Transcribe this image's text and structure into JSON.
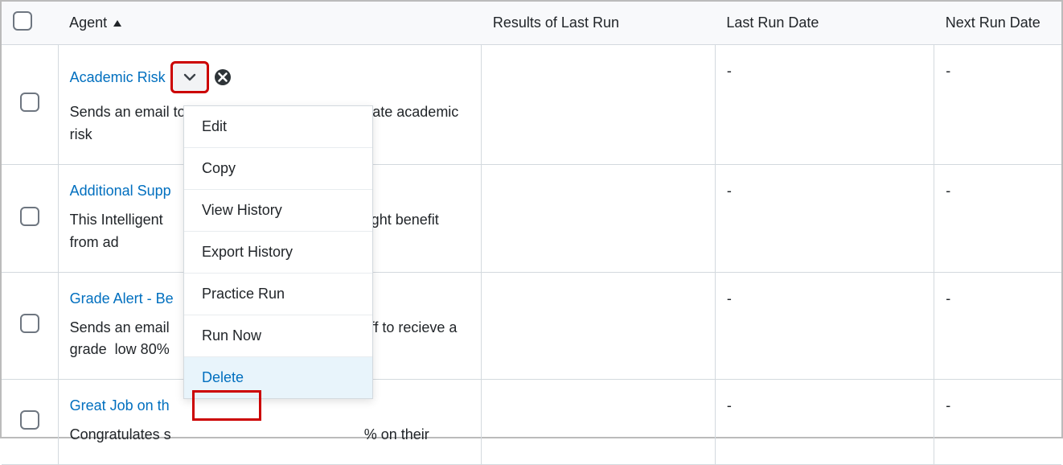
{
  "columns": {
    "agent": "Agent",
    "results": "Results of Last Run",
    "lastRun": "Last Run Date",
    "nextRun": "Next Run Date"
  },
  "rows": [
    {
      "name": "Academic Risk",
      "desc": "Sends an email to the student's Advisor to indicate academic risk",
      "results": "",
      "lastRun": "-",
      "nextRun": "-"
    },
    {
      "name": "Additional Supp",
      "desc_prefix": "This Intelligent",
      "desc_suffix": "might benefit from ad",
      "results": "",
      "lastRun": "-",
      "nextRun": "-"
    },
    {
      "name": "Grade Alert - Be",
      "desc_prefix": "Sends an email",
      "desc_mid": "off to recieve a grade",
      "desc_suffix": "low 80%",
      "results": "",
      "lastRun": "-",
      "nextRun": "-"
    },
    {
      "name": "Great Job on th",
      "desc_prefix": "Congratulates s",
      "desc_suffix": "% on their",
      "results": "",
      "lastRun": "-",
      "nextRun": "-"
    }
  ],
  "menu": {
    "edit": "Edit",
    "copy": "Copy",
    "viewHistory": "View History",
    "exportHistory": "Export History",
    "practiceRun": "Practice Run",
    "runNow": "Run Now",
    "delete": "Delete"
  }
}
